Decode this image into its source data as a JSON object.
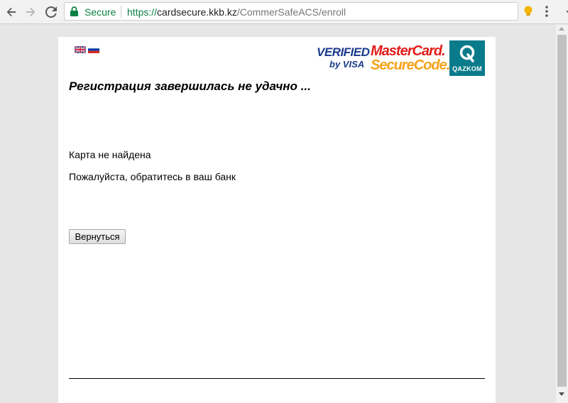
{
  "browser": {
    "secure_label": "Secure",
    "url_scheme": "https://",
    "url_host": "cardsecure.kkb.kz",
    "url_path": "/CommerSafeACS/enroll"
  },
  "logos": {
    "visa_top": "VERIFIED",
    "visa_bottom": "by VISA",
    "mc_top": "MasterCard.",
    "mc_bottom": "SecureCode.",
    "qazkom_letter": "Q",
    "qazkom_text": "QAZKOM"
  },
  "content": {
    "heading": "Регистрация завершилась не удачно ...",
    "message_1": "Карта не найдена",
    "message_2": "Пожалуйста, обратитесь в ваш банк",
    "back_button": "Вернуться"
  },
  "colors": {
    "secure_green": "#0b8043",
    "visa_blue": "#1a3a8a",
    "mastercard_red": "#e31d1a",
    "securecode_orange": "#f7a21a",
    "qazkom_teal": "#0a7b8a"
  }
}
